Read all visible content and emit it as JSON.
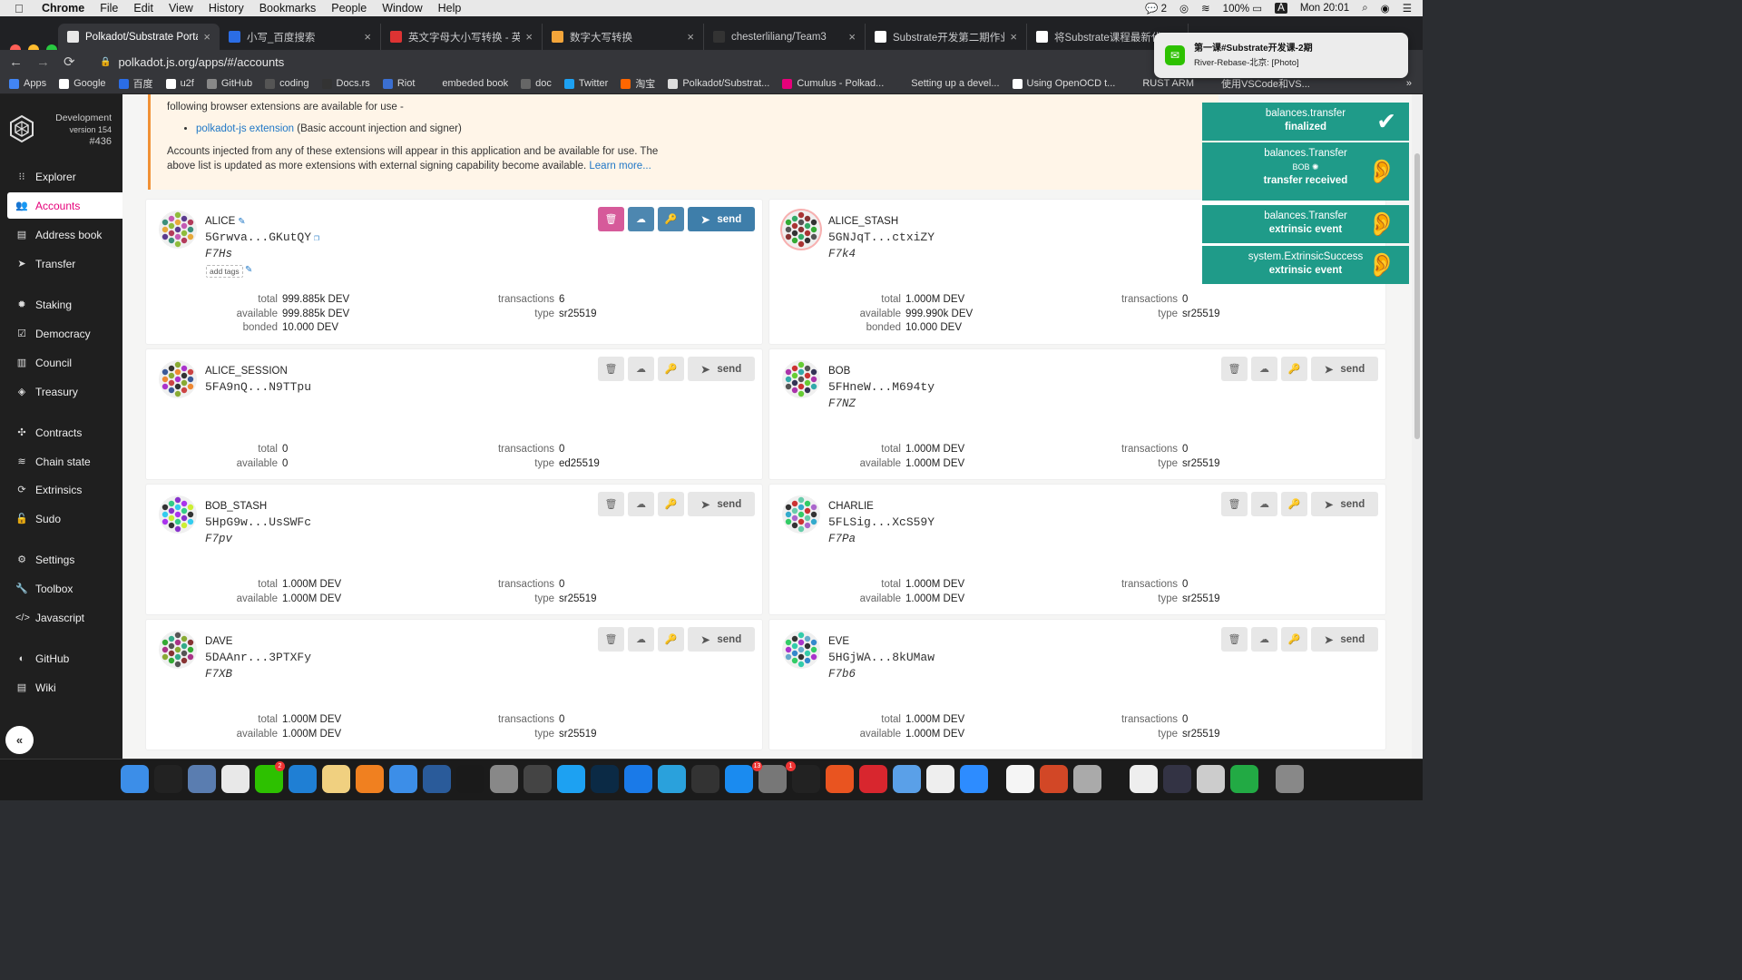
{
  "menubar": {
    "app": "Chrome",
    "items": [
      "File",
      "Edit",
      "View",
      "History",
      "Bookmarks",
      "People",
      "Window",
      "Help"
    ],
    "wechat_count": "2",
    "battery": "100%",
    "input_source": "A",
    "clock": "Mon 20:01"
  },
  "tabs": [
    {
      "label": "Polkadot/Substrate Portal",
      "color": "#e8e8e8",
      "active": true
    },
    {
      "label": "小写_百度搜索",
      "color": "#2b6de5"
    },
    {
      "label": "英文字母大小写转换 - 英文大",
      "color": "#d33"
    },
    {
      "label": "数字大写转换",
      "color": "#f4a53a"
    },
    {
      "label": "chesterliliang/Team3",
      "color": "#333"
    },
    {
      "label": "Substrate开发第二期作业名",
      "color": "#fff"
    },
    {
      "label": "将Substrate课程最新代",
      "color": "#fff"
    }
  ],
  "address": {
    "url": "polkadot.js.org/apps/#/accounts"
  },
  "bookmarks": [
    {
      "label": "Apps",
      "color": "#4285f4"
    },
    {
      "label": "Google",
      "color": "#fff"
    },
    {
      "label": "百度",
      "color": "#2b6de5"
    },
    {
      "label": "u2f",
      "color": "#fff"
    },
    {
      "label": "GitHub",
      "color": "#888"
    },
    {
      "label": "coding",
      "color": "#555"
    },
    {
      "label": "Docs.rs",
      "color": "#333"
    },
    {
      "label": "Riot",
      "color": "#3b6fd1"
    },
    {
      "label": "embeded book",
      "color": "#35363a"
    },
    {
      "label": "doc",
      "color": "#666"
    },
    {
      "label": "Twitter",
      "color": "#1da1f2"
    },
    {
      "label": "淘宝",
      "color": "#f60"
    },
    {
      "label": "Polkadot/Substrat...",
      "color": "#ddd"
    },
    {
      "label": "Cumulus - Polkad...",
      "color": "#e6007a"
    },
    {
      "label": "Setting up a devel...",
      "color": "#35363a"
    },
    {
      "label": "Using OpenOCD t...",
      "color": "#fff"
    },
    {
      "label": "RUST ARM",
      "color": "#35363a"
    },
    {
      "label": "使用VSCode和VS...",
      "color": "#35363a"
    }
  ],
  "chain": {
    "name": "Development",
    "version": "version 154",
    "block": "#436"
  },
  "sidebar": {
    "items": [
      {
        "label": "Explorer",
        "icon": "⁝⁝"
      },
      {
        "label": "Accounts",
        "icon": "👥",
        "active": true
      },
      {
        "label": "Address book",
        "icon": "▤"
      },
      {
        "label": "Transfer",
        "icon": "➤"
      },
      {
        "label": "Staking",
        "icon": "✹"
      },
      {
        "label": "Democracy",
        "icon": "☑"
      },
      {
        "label": "Council",
        "icon": "▥"
      },
      {
        "label": "Treasury",
        "icon": "◈"
      },
      {
        "label": "Contracts",
        "icon": "✣"
      },
      {
        "label": "Chain state",
        "icon": "≋"
      },
      {
        "label": "Extrinsics",
        "icon": "⟳"
      },
      {
        "label": "Sudo",
        "icon": "🔓"
      },
      {
        "label": "Settings",
        "icon": "⚙"
      },
      {
        "label": "Toolbox",
        "icon": "🔧"
      },
      {
        "label": "Javascript",
        "icon": "</>"
      },
      {
        "label": "GitHub",
        "icon": "◐"
      },
      {
        "label": "Wiki",
        "icon": "▤"
      }
    ],
    "collapse_icon": "«"
  },
  "notice": {
    "line1": "following browser extensions are available for use -",
    "ext_link": "polkadot-js extension",
    "ext_desc": " (Basic account injection and signer)",
    "line2": "Accounts injected from any of these extensions will appear in this application and be available for use. The",
    "line3": "above list is updated as more extensions with external signing capability become available.",
    "learn_more": "Learn more..."
  },
  "account_labels": {
    "total": "total",
    "available": "available",
    "bonded": "bonded",
    "transactions": "transactions",
    "type": "type",
    "send": "send",
    "add_tags": "add tags"
  },
  "accounts": [
    {
      "name": "ALICE",
      "address": "5Grwva...GKutQY",
      "index": "F7Hs",
      "total": "999.885k DEV",
      "available": "999.885k DEV",
      "bonded": "10.000 DEV",
      "transactions": "6",
      "type": "sr25519"
    },
    {
      "name": "ALICE_STASH",
      "address": "5GNJqT...ctxiZY",
      "index": "F7k4",
      "total": "1.000M DEV",
      "available": "999.990k DEV",
      "bonded": "10.000 DEV",
      "transactions": "0",
      "type": "sr25519"
    },
    {
      "name": "ALICE_SESSION",
      "address": "5FA9nQ...N9TTpu",
      "index": "",
      "total": "0",
      "available": "0",
      "transactions": "0",
      "type": "ed25519"
    },
    {
      "name": "BOB",
      "address": "5FHneW...M694ty",
      "index": "F7NZ",
      "total": "1.000M DEV",
      "available": "1.000M DEV",
      "transactions": "0",
      "type": "sr25519"
    },
    {
      "name": "BOB_STASH",
      "address": "5HpG9w...UsSWFc",
      "index": "F7pv",
      "total": "1.000M DEV",
      "available": "1.000M DEV",
      "transactions": "0",
      "type": "sr25519"
    },
    {
      "name": "CHARLIE",
      "address": "5FLSig...XcS59Y",
      "index": "F7Pa",
      "total": "1.000M DEV",
      "available": "1.000M DEV",
      "transactions": "0",
      "type": "sr25519"
    },
    {
      "name": "DAVE",
      "address": "5DAAnr...3PTXFy",
      "index": "F7XB",
      "total": "1.000M DEV",
      "available": "1.000M DEV",
      "transactions": "0",
      "type": "sr25519"
    },
    {
      "name": "EVE",
      "address": "5HGjWA...8kUMaw",
      "index": "F7b6",
      "total": "1.000M DEV",
      "available": "1.000M DEV",
      "transactions": "0",
      "type": "sr25519"
    }
  ],
  "events": [
    {
      "title": "balances.transfer",
      "status": "finalized",
      "icon": "✔"
    },
    {
      "title": "balances.Transfer",
      "who": "BOB",
      "status": "transfer received",
      "icon": "👂"
    },
    {
      "title": "balances.Transfer",
      "status": "extrinsic event",
      "icon": "👂"
    },
    {
      "title": "system.ExtrinsicSuccess",
      "status": "extrinsic event",
      "icon": "👂"
    }
  ],
  "wechat": {
    "title": "第一课#Substrate开发课-2期",
    "body": "River-Rebase-北京: [Photo]"
  },
  "dock": {
    "badges": {
      "wechat": "2",
      "appstore": "13",
      "prefs": "1"
    }
  }
}
